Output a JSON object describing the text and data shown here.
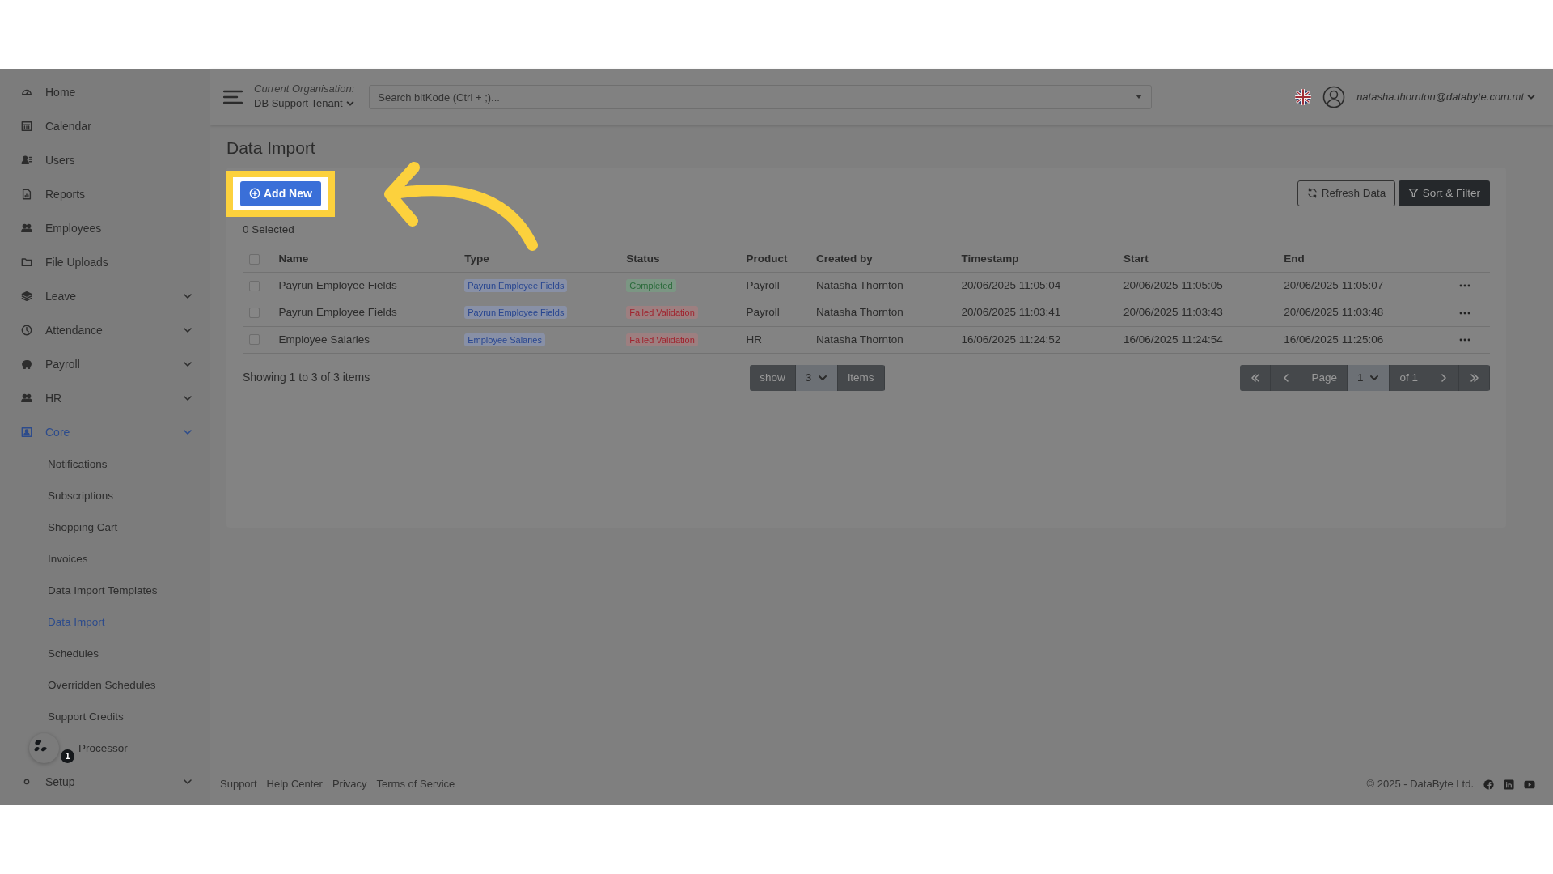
{
  "sidebar": {
    "items": [
      {
        "label": "Home",
        "selected": false
      },
      {
        "label": "Calendar",
        "selected": false
      },
      {
        "label": "Users",
        "selected": false
      },
      {
        "label": "Reports",
        "selected": false
      },
      {
        "label": "Employees",
        "selected": false
      },
      {
        "label": "File Uploads",
        "selected": false
      },
      {
        "label": "Leave",
        "selected": false,
        "kind": "group"
      },
      {
        "label": "Attendance",
        "selected": false,
        "kind": "group"
      },
      {
        "label": "Payroll",
        "selected": false,
        "kind": "group"
      },
      {
        "label": "HR",
        "selected": false,
        "kind": "group"
      },
      {
        "label": "Core",
        "selected": true,
        "kind": "group",
        "expanded": true,
        "children": [
          {
            "label": "Notifications",
            "selected": false
          },
          {
            "label": "Subscriptions",
            "selected": false
          },
          {
            "label": "Shopping Cart",
            "selected": false
          },
          {
            "label": "Invoices",
            "selected": false
          },
          {
            "label": "Data Import Templates",
            "selected": false
          },
          {
            "label": "Data Import",
            "selected": true
          },
          {
            "label": "Schedules",
            "selected": false
          },
          {
            "label": "Overridden Schedules",
            "selected": false
          },
          {
            "label": "Support Credits",
            "selected": false
          },
          {
            "label": "Processor",
            "selected": false
          }
        ]
      },
      {
        "label": "Setup",
        "selected": false,
        "kind": "group"
      }
    ]
  },
  "topbar": {
    "org_label": "Current Organisation:",
    "org_value": "DB Support Tenant",
    "search": {
      "placeholder": "Search bitKode (Ctrl + ;)..."
    },
    "user": "natasha.thornton@databyte.com.mt"
  },
  "page_title": "Data Import",
  "toolbar": {
    "add_button": "Add New",
    "refresh_button": "Refresh Data",
    "filter_button": "Sort & Filter"
  },
  "selected_count": "0 Selected",
  "table": {
    "columns": [
      "Name",
      "Type",
      "Status",
      "Product",
      "Created by",
      "Timestamp",
      "Start",
      "End"
    ],
    "select_all_checked": false,
    "rows": [
      {
        "checked": false,
        "name": "Payrun Employee Fields",
        "type": "Payrun Employee Fields",
        "status": {
          "kind": "success",
          "text": "Completed"
        },
        "product": "Payroll",
        "created_by": "Natasha Thornton",
        "timestamp": "20/06/2025 11:05:04",
        "start": "20/06/2025 11:05:05",
        "end": "20/06/2025 11:05:07"
      },
      {
        "checked": false,
        "name": "Payrun Employee Fields",
        "type": "Payrun Employee Fields",
        "status": {
          "kind": "error",
          "text": "Failed Validation"
        },
        "product": "Payroll",
        "created_by": "Natasha Thornton",
        "timestamp": "20/06/2025 11:03:41",
        "start": "20/06/2025 11:03:43",
        "end": "20/06/2025 11:03:48"
      },
      {
        "checked": false,
        "name": "Employee Salaries",
        "type": "Employee Salaries",
        "status": {
          "kind": "error",
          "text": "Failed Validation"
        },
        "product": "HR",
        "created_by": "Natasha Thornton",
        "timestamp": "16/06/2025 11:24:52",
        "start": "16/06/2025 11:24:54",
        "end": "16/06/2025 11:25:06"
      }
    ]
  },
  "summary": "Showing 1 to 3 of 3 items",
  "page_size": {
    "show_label": "show",
    "value": "3",
    "items_label": "items"
  },
  "pagination": {
    "page_label": "Page",
    "page_value": "1",
    "of_label": "of 1"
  },
  "footer": {
    "links": [
      "Support",
      "Help Center",
      "Privacy",
      "Terms of Service"
    ],
    "copyright": "© 2025 - DataByte Ltd."
  },
  "chat_widget": {
    "badge": "1"
  }
}
